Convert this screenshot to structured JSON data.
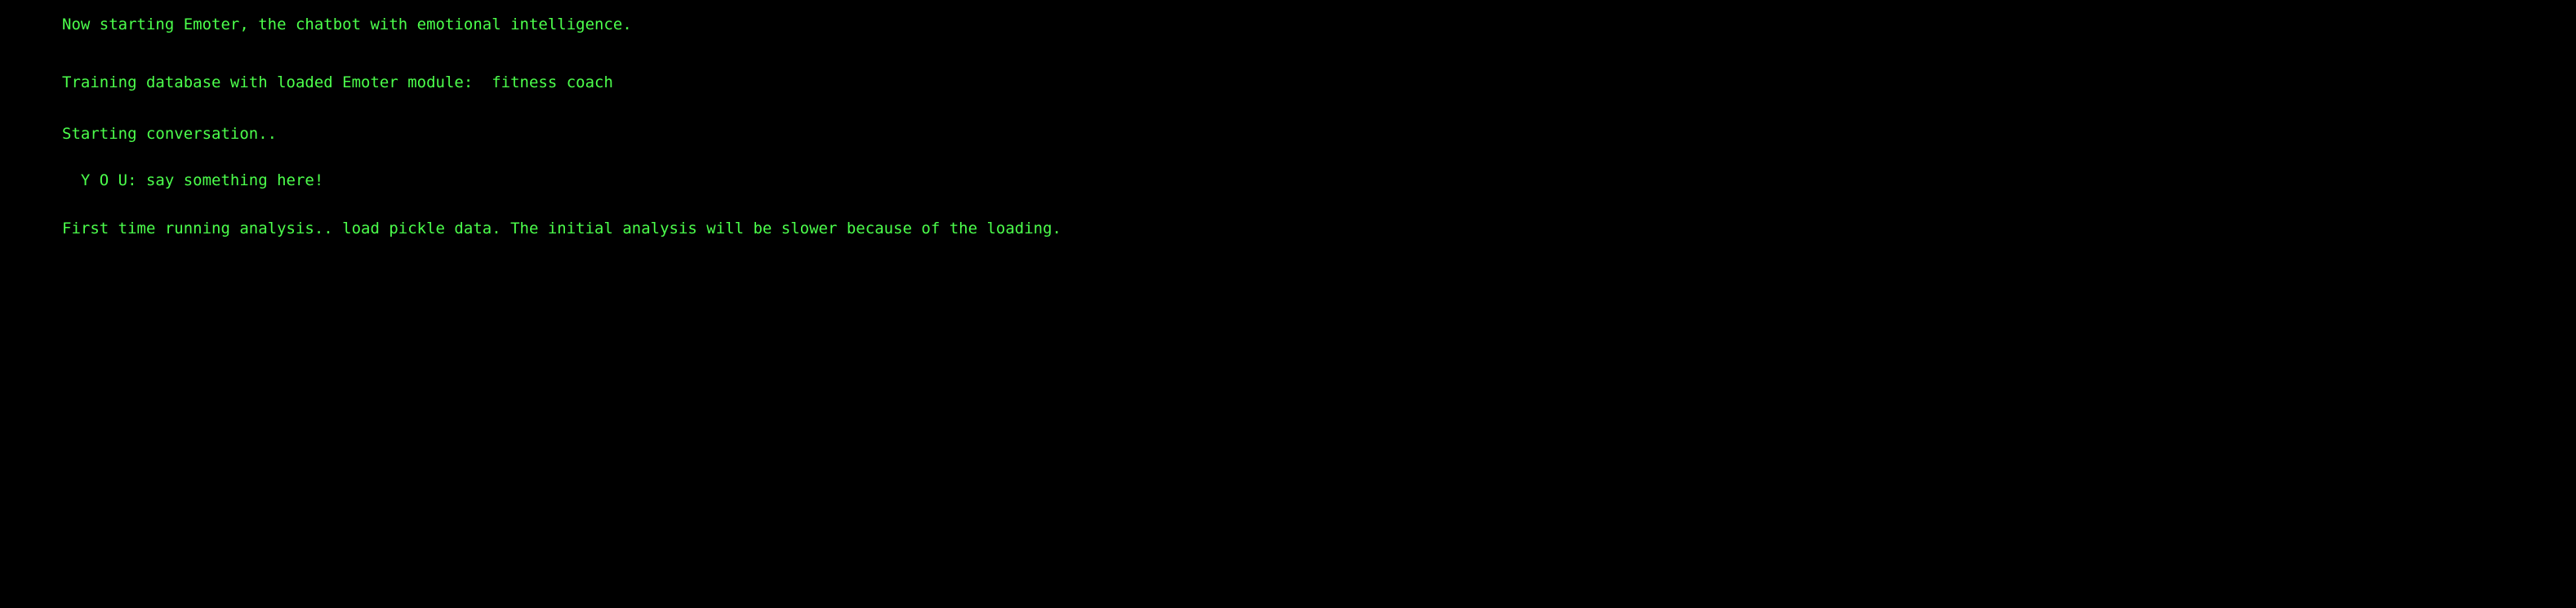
{
  "theme": {
    "background": "#000000",
    "text_color": "#4cff4c"
  },
  "terminal": {
    "lines": [
      "Now starting Emoter, the chatbot with emotional intelligence.",
      "Training database with loaded Emoter module:  fitness coach",
      "Starting conversation..",
      "  Y O U: say something here!",
      "First time running analysis.. load pickle data. The initial analysis will be slower because of the loading."
    ]
  }
}
